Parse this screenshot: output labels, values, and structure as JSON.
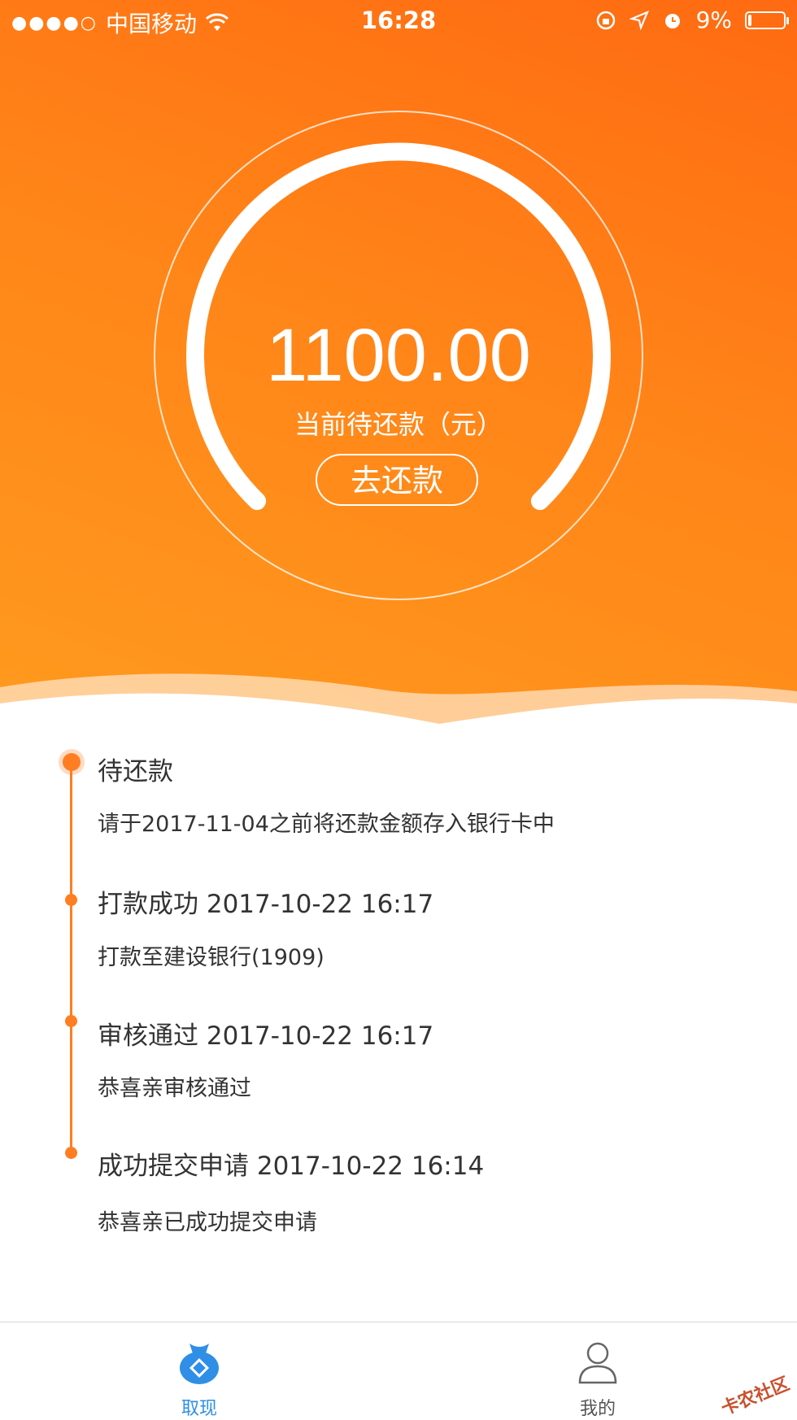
{
  "status_bar": {
    "signal": "●●●●○",
    "carrier": "中国移动",
    "time": "16:28",
    "battery": "9%",
    "battery_fraction": 0.09
  },
  "hero": {
    "amount": "1100.00",
    "amount_label": "当前待还款（元）",
    "repay_button": "去还款"
  },
  "timeline": [
    {
      "title": "待还款",
      "desc": "请于2017-11-04之前将还款金额存入银行卡中"
    },
    {
      "title": "打款成功 2017-10-22 16:17",
      "desc": "打款至建设银行(1909)"
    },
    {
      "title": "审核通过 2017-10-22 16:17",
      "desc": "恭喜亲审核通过"
    },
    {
      "title": "成功提交申请 2017-10-22 16:14",
      "desc": "恭喜亲已成功提交申请"
    }
  ],
  "tabs": [
    {
      "label": "取现",
      "icon": "money-bag-icon",
      "active": true
    },
    {
      "label": "我的",
      "icon": "user-icon",
      "active": false
    }
  ],
  "watermark": "卡农社区",
  "colors": {
    "accent": "#ff7e22",
    "active_tab": "#2f8fe6",
    "inactive_tab": "#555555"
  }
}
